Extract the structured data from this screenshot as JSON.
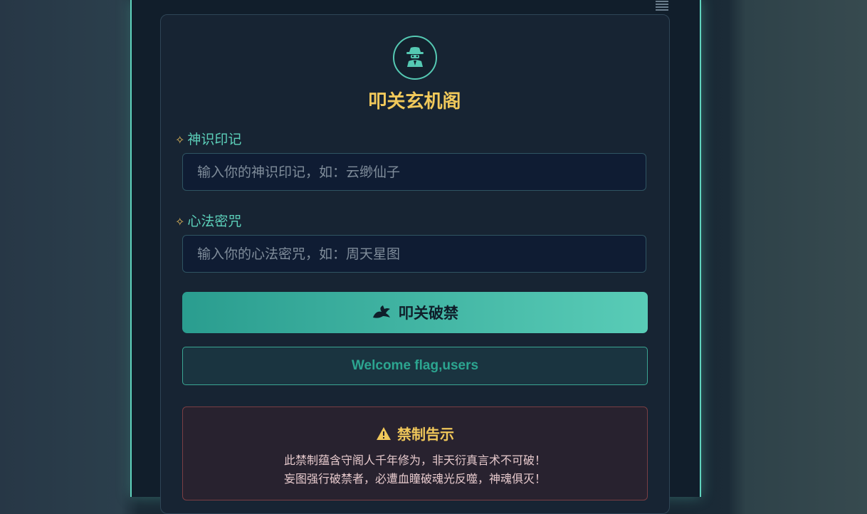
{
  "header": {
    "menu_icon": "menu-icon"
  },
  "brand": {
    "emblem_icon": "spy-icon",
    "title": "叩关玄机阁"
  },
  "fields": {
    "username": {
      "label": "神识印记",
      "placeholder": "输入你的神识印记，如：云缈仙子",
      "icon": "sparkle-icon"
    },
    "password": {
      "label": "心法密咒",
      "placeholder": "输入你的心法密咒，如：周天星图",
      "icon": "sparkle-icon"
    }
  },
  "submit": {
    "label": "叩关破禁",
    "icon": "dragon-icon"
  },
  "welcome": {
    "text": "Welcome flag,users"
  },
  "warning": {
    "title": "禁制告示",
    "icon": "warning-icon",
    "line1": "此禁制蕴含守阁人千年修为，非天衍真言术不可破！",
    "line2": "妄图强行破禁者，必遭血瞳破魂光反噬，神魂俱灭！"
  },
  "colors": {
    "accent": "#5fd3bd",
    "title": "#f1c95b",
    "button_start": "#2a9d8f",
    "button_end": "#59ccb7"
  }
}
